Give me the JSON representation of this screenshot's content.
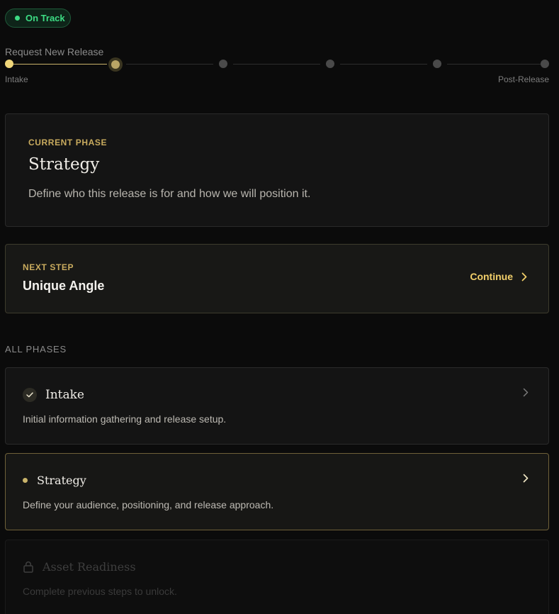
{
  "status": {
    "label": "On Track",
    "color": "#3ddc84"
  },
  "release": {
    "title": "Request New Release",
    "stepper": {
      "total_steps": 6,
      "current_step": 2,
      "start_label": "Intake",
      "end_label": "Post-Release"
    }
  },
  "current_phase": {
    "eyebrow": "CURRENT PHASE",
    "title": "Strategy",
    "description": "Define who this release is for and how we will position it."
  },
  "next_step": {
    "eyebrow": "NEXT STEP",
    "title": "Unique Angle",
    "action_label": "Continue"
  },
  "all_phases": {
    "label": "ALL PHASES",
    "items": [
      {
        "title": "Intake",
        "description": "Initial information gathering and release setup.",
        "state": "complete",
        "icon": "check-icon"
      },
      {
        "title": "Strategy",
        "description": "Define your audience, positioning, and release approach.",
        "state": "active",
        "icon": "dot-icon"
      },
      {
        "title": "Asset Readiness",
        "description": "Complete previous steps to unlock.",
        "state": "locked",
        "icon": "lock-icon"
      }
    ]
  },
  "colors": {
    "accent": "#c9b36a",
    "accent_bright": "#f2cf6a",
    "background": "#0b0b0b"
  }
}
